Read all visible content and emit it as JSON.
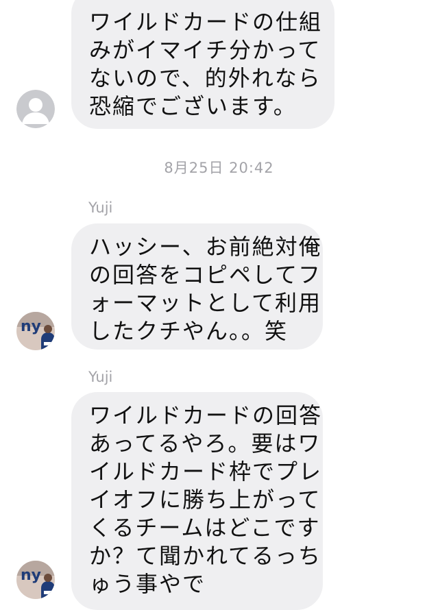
{
  "timestamp": "8月25日 20:42",
  "messages": [
    {
      "lines": [
        "ワイルドカードの仕組",
        "みがイマイチ分かって",
        "ないので、的外れなら",
        "恐縮でございます。"
      ]
    },
    {
      "sender": "Yuji",
      "lines": [
        "ハッシー、お前絶対俺",
        "の回答をコピペしてフ",
        "ォーマットとして利用",
        "したクチやん。。笑"
      ]
    },
    {
      "sender": "Yuji",
      "lines": [
        "ワイルドカードの回答",
        "あってるやろ。要はワ",
        "イルドカード枠でプレ",
        "イオフに勝ち上がって",
        "くるチームはどこです",
        "か？て聞かれてるっち",
        "ゅう事やで"
      ]
    }
  ],
  "avatars": {
    "default": {
      "icon": "person-silhouette-icon",
      "color": "#c9cace"
    },
    "yuji": {
      "icon": "ny-giants-logo",
      "logo_text": "ny",
      "logo_color": "#1f3c78",
      "accent": "#c8102e"
    }
  },
  "colors": {
    "bubble": "#efeff1",
    "text": "#111111",
    "meta_text": "#a3a3a8"
  }
}
